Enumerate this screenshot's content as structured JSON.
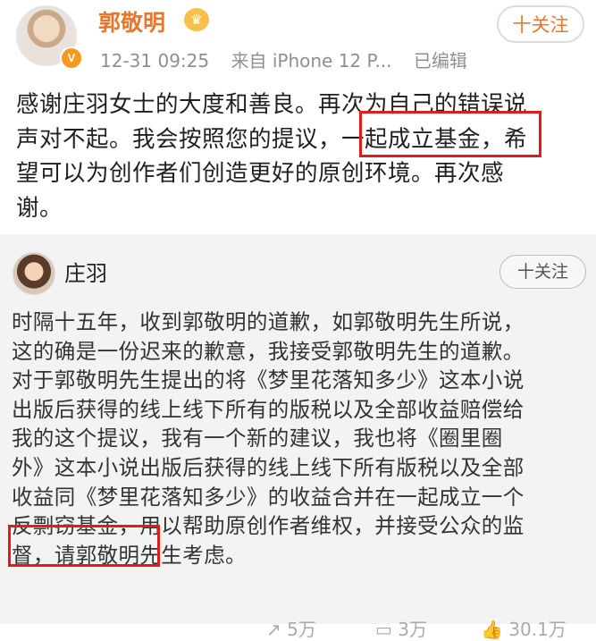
{
  "post": {
    "username": "郭敬明",
    "crown_icon": "crown-icon",
    "verified_icon": "verified-v-icon",
    "time": "12-31 09:25",
    "source": "来自 iPhone 12 P...",
    "edited": "已编辑",
    "follow_label": "十关注",
    "text_lines": [
      "感谢庄羽女士的大度和善良。再次为自己的错误说",
      "声对不起。我会按照您的提议，一起成立基金，希",
      "望可以为创作者们创造更好的原创环境。再次感",
      "谢。"
    ],
    "highlight_color": "#e31b1b"
  },
  "repost": {
    "username": "庄羽",
    "follow_label": "十关注",
    "text_lines": [
      "时隔十五年，收到郭敬明的道歉，如郭敬明先生所说，",
      "这的确是一份迟来的歉意，我接受郭敬明先生的道歉。",
      "对于郭敬明先生提出的将《梦里花落知多少》这本小说",
      "出版后获得的线上线下所有的版税以及全部收益赔偿给",
      "我的这个提议，我有一个新的建议，我也将《圈里圈",
      "外》这本小说出版后获得的线上线下所有版税以及全部",
      "收益同《梦里花落知多少》的收益合并在一起成立一个",
      "反剽窃基金，用以帮助原创作者维权，并接受公众的监",
      "督，请郭敬明先生考虑。"
    ],
    "actions": {
      "repost_count": "5万",
      "comment_count": "3万",
      "like_count": "30.1万"
    }
  },
  "colors": {
    "username_orange": "#e8772e",
    "repost_bg": "#f3f3f3",
    "highlight": "#e31b1b"
  }
}
